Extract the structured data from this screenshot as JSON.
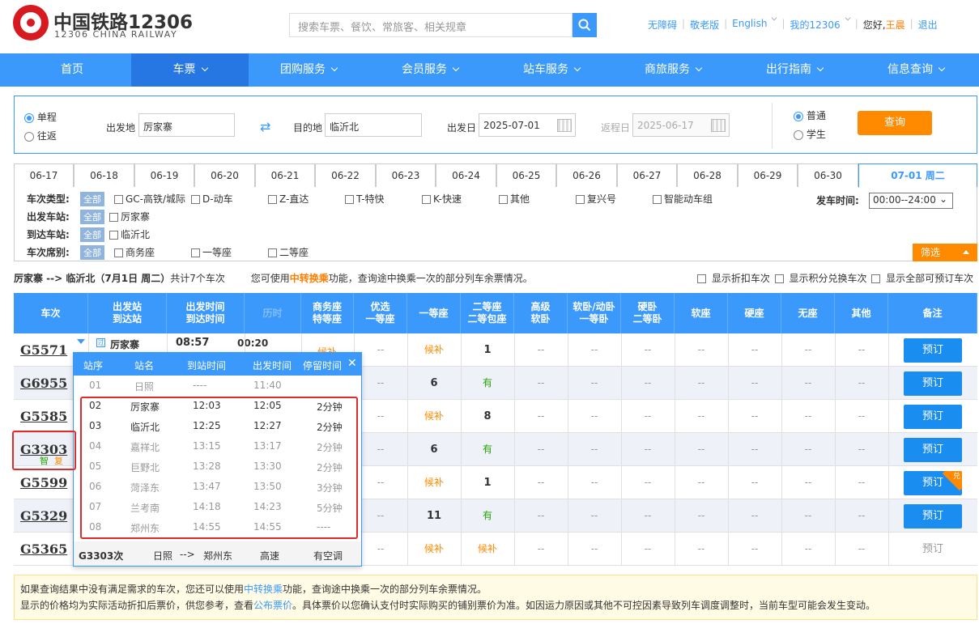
{
  "header": {
    "logo_cn": "中国铁路12306",
    "logo_en": "12306 CHINA RAILWAY",
    "search_placeholder": "搜索车票、餐饮、常旅客、相关规章",
    "links": {
      "accessible": "无障碍",
      "elder": "敬老版",
      "english": "English",
      "my12306": "我的12306",
      "greeting": "您好,",
      "user": "王晨",
      "logout": "退出"
    }
  },
  "nav": [
    "首页",
    "车票",
    "团购服务",
    "会员服务",
    "站车服务",
    "商旅服务",
    "出行指南",
    "信息查询"
  ],
  "query": {
    "trip_one": "单程",
    "trip_round": "往返",
    "from_label": "出发地",
    "from_value": "厉家寨",
    "to_label": "目的地",
    "to_value": "临沂北",
    "date_label": "出发日",
    "date_value": "2025-07-01",
    "return_label": "返程日",
    "return_value": "2025-06-17",
    "type_normal": "普通",
    "type_student": "学生",
    "query_button": "查询"
  },
  "dates": [
    "06-17",
    "06-18",
    "06-19",
    "06-20",
    "06-21",
    "06-22",
    "06-23",
    "06-24",
    "06-25",
    "06-26",
    "06-27",
    "06-28",
    "06-29",
    "06-30",
    "07-01 周二"
  ],
  "filters": {
    "type_label": "车次类型:",
    "all": "全部",
    "types": [
      "GC-高铁/城际",
      "D-动车",
      "Z-直达",
      "T-特快",
      "K-快速",
      "其他",
      "复兴号",
      "智能动车组"
    ],
    "depart_time_label": "发车时间:",
    "depart_time_value": "00:00--24:00",
    "from_label": "出发车站:",
    "from_station": "厉家寨",
    "to_label": "到达车站:",
    "to_station": "临沂北",
    "seat_label": "车次席别:",
    "seats": [
      "商务座",
      "一等座",
      "二等座"
    ],
    "filter_button": "筛选"
  },
  "summary": {
    "route": "厉家寨 --> 临沂北（7月1日  周二）",
    "count": "共计7个车次",
    "hint_pre": "您可使用",
    "hint_link": "中转换乘",
    "hint_post": "功能，查询途中换乘一次的部分列车余票情况。",
    "opt1": "显示折扣车次",
    "opt2": "显示积分兑换车次",
    "opt3": "显示全部可预订车次"
  },
  "table_headers": [
    [
      "车次"
    ],
    [
      "出发站",
      "到达站"
    ],
    [
      "出发时间",
      "到达时间"
    ],
    [
      "历时"
    ],
    [
      "商务座",
      "特等座"
    ],
    [
      "优选",
      "一等座"
    ],
    [
      "一等座"
    ],
    [
      "二等座",
      "二等包座"
    ],
    [
      "高级",
      "软卧"
    ],
    [
      "软卧/动卧",
      "一等卧"
    ],
    [
      "硬卧",
      "二等卧"
    ],
    [
      "软座"
    ],
    [
      "硬座"
    ],
    [
      "无座"
    ],
    [
      "其他"
    ],
    [
      "备注"
    ]
  ],
  "trains": [
    {
      "no": "G5571",
      "from": "厉家寨",
      "dep": "08:57",
      "dur": "00:20",
      "swz": "候补",
      "ydz": "候补",
      "edz": "1",
      "book": "预订"
    },
    {
      "no": "G6955",
      "ydz": "6",
      "edz": "有",
      "book": "预订"
    },
    {
      "no": "G5585",
      "ydz": "候补",
      "edz": "8",
      "book": "预订"
    },
    {
      "no": "G3303",
      "tags": [
        "智",
        "复"
      ],
      "ydz": "6",
      "edz": "有",
      "book": "预订"
    },
    {
      "no": "G5599",
      "ydz": "候补",
      "edz": "1",
      "book": "预订",
      "badge": "兑"
    },
    {
      "no": "G5329",
      "ydz": "11",
      "edz": "有",
      "book": "预订"
    },
    {
      "no": "G5365",
      "ydz": "候补",
      "edz": "候补",
      "book": "预订"
    }
  ],
  "dash": "--",
  "popup": {
    "headers": [
      "站序",
      "站名",
      "到站时间",
      "出发时间",
      "停留时间"
    ],
    "stops": [
      {
        "seq": "01",
        "name": "日照",
        "arr": "----",
        "dep": "11:40",
        "stay": ""
      },
      {
        "seq": "02",
        "name": "厉家寨",
        "arr": "12:03",
        "dep": "12:05",
        "stay": "2分钟"
      },
      {
        "seq": "03",
        "name": "临沂北",
        "arr": "12:25",
        "dep": "12:27",
        "stay": "2分钟"
      },
      {
        "seq": "04",
        "name": "嘉祥北",
        "arr": "13:15",
        "dep": "13:17",
        "stay": "2分钟"
      },
      {
        "seq": "05",
        "name": "巨野北",
        "arr": "13:28",
        "dep": "13:30",
        "stay": "2分钟"
      },
      {
        "seq": "06",
        "name": "菏泽东",
        "arr": "13:47",
        "dep": "13:50",
        "stay": "3分钟"
      },
      {
        "seq": "07",
        "name": "兰考南",
        "arr": "14:18",
        "dep": "14:23",
        "stay": "5分钟"
      },
      {
        "seq": "08",
        "name": "郑州东",
        "arr": "14:55",
        "dep": "14:55",
        "stay": "----"
      }
    ],
    "footer": {
      "train": "G3303次",
      "from": "日照",
      "arrow": "-->",
      "to": "郑州东",
      "type": "高速",
      "ac": "有空调"
    }
  },
  "note": {
    "line1_pre": "如果查询结果中没有满足需求的车次，您还可以使用",
    "line1_link": "中转换乘",
    "line1_post": "功能，查询途中换乘一次的部分列车余票情况。",
    "line2_pre": "显示的价格均为实际活动折扣后票价，供您参考，查看",
    "line2_link": "公布票价",
    "line2_post": "。具体票价以您确认支付时实际购买的铺别票价为准。如因运力原因或其他不可控因素导致列车调度调整时，当前车型可能会发生变动。"
  },
  "colors": {
    "primary": "#3b99fc",
    "active_nav": "#2676e3",
    "orange": "#ff8a00",
    "book_button": "#1a8df0",
    "highlight_red": "#e02b2b",
    "available_green": "#26a306"
  }
}
